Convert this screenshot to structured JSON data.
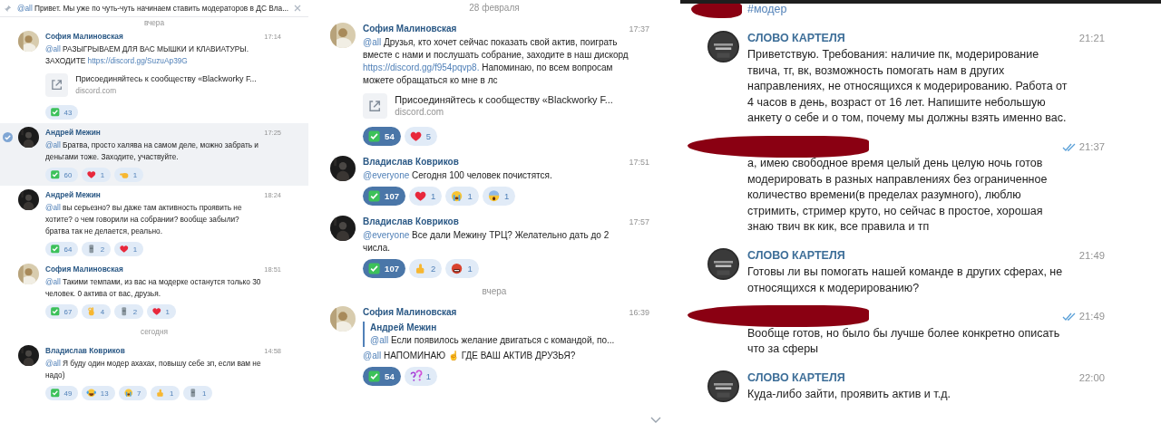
{
  "panels": [
    {
      "floating_date": "вчера",
      "pinned": {
        "parts": [
          {
            "kind": "mention",
            "text": "@all"
          },
          {
            "kind": "text",
            "text": " Привет. Мы уже по чуть-чуть начинаем ставить модераторов в ДС Вла..."
          }
        ]
      },
      "items": [
        {
          "kind": "message",
          "author": "София Малиновская",
          "time": "17:14",
          "selected": false,
          "parts": [
            {
              "kind": "mention",
              "text": "@all"
            },
            {
              "kind": "text",
              "text": " РАЗЫГРЫВАЕМ ДЛЯ ВАС МЫШКИ И КЛАВИАТУРЫ. ЗАХОДИТЕ "
            },
            {
              "kind": "link",
              "text": "https://discord.gg/SuzuAp39G"
            }
          ],
          "preview": {
            "title": "Присоединяйтесь к сообществу «Blackworky F...",
            "domain": "discord.com"
          },
          "reactions": [
            {
              "kind": "check",
              "count": "43",
              "selected": false
            }
          ]
        },
        {
          "kind": "message",
          "author": "Андрей Межин",
          "time": "17:25",
          "selected": true,
          "parts": [
            {
              "kind": "mention",
              "text": "@all"
            },
            {
              "kind": "text",
              "text": " Братва, просто халява на самом деле, можно забрать и деньгами тоже. Заходите, участвуйте."
            }
          ],
          "reactions": [
            {
              "kind": "check",
              "count": "60",
              "selected": false
            },
            {
              "kind": "heart",
              "count": "1",
              "selected": false
            },
            {
              "kind": "point",
              "count": "1",
              "selected": false
            }
          ]
        },
        {
          "kind": "message",
          "author": "Андрей Межин",
          "time": "18:24",
          "selected": false,
          "parts": [
            {
              "kind": "mention",
              "text": "@all"
            },
            {
              "kind": "text",
              "text": " вы серьезно? вы даже там активность проявить не хотите? о чем говорили на собрании? вообще забыли? братва так не делается, реально."
            }
          ],
          "reactions": [
            {
              "kind": "check",
              "count": "64",
              "selected": false
            },
            {
              "kind": "moai",
              "count": "2",
              "selected": false
            },
            {
              "kind": "heart",
              "count": "1",
              "selected": false
            }
          ]
        },
        {
          "kind": "message",
          "author": "София Малиновская",
          "time": "18:51",
          "selected": false,
          "parts": [
            {
              "kind": "mention",
              "text": "@all"
            },
            {
              "kind": "text",
              "text": " Такими темпами, из вас на модерке останутся только 30 человек. 0 актива от вас, друзья."
            }
          ],
          "reactions": [
            {
              "kind": "check",
              "count": "67",
              "selected": false
            },
            {
              "kind": "ok",
              "count": "4",
              "selected": false
            },
            {
              "kind": "moai",
              "count": "2",
              "selected": false
            },
            {
              "kind": "heart",
              "count": "1",
              "selected": false
            }
          ]
        },
        {
          "kind": "date",
          "text": "сегодня"
        },
        {
          "kind": "message",
          "author": "Владислав Ковриков",
          "time": "14:58",
          "selected": false,
          "parts": [
            {
              "kind": "mention",
              "text": "@all"
            },
            {
              "kind": "text",
              "text": " Я буду один модер ахахах, повышу себе зп, если вам не надо)"
            }
          ],
          "reactions": [
            {
              "kind": "check",
              "count": "49",
              "selected": false
            },
            {
              "kind": "laugh",
              "count": "13",
              "selected": false
            },
            {
              "kind": "cry",
              "count": "7",
              "selected": false
            },
            {
              "kind": "thumbs",
              "count": "1",
              "selected": false
            },
            {
              "kind": "moai",
              "count": "1",
              "selected": false
            }
          ]
        }
      ]
    },
    {
      "items": [
        {
          "kind": "date",
          "text": "28 февраля"
        },
        {
          "kind": "message",
          "author": "София Малиновская",
          "time": "17:37",
          "selected": false,
          "parts": [
            {
              "kind": "mention",
              "text": "@all"
            },
            {
              "kind": "text",
              "text": " Друзья, кто хочет сейчас показать свой актив, поиграть вместе с нами и послушать собрание, заходите в наш дискорд "
            },
            {
              "kind": "link",
              "text": "https://discord.gg/f954pqvp8."
            },
            {
              "kind": "text",
              "text": " Напоминаю, по всем вопросам можете обращаться ко мне в лс"
            }
          ],
          "preview": {
            "title": "Присоединяйтесь к сообществу «Blackworky F...",
            "domain": "discord.com"
          },
          "reactions": [
            {
              "kind": "check",
              "count": "54",
              "selected": true
            },
            {
              "kind": "heart",
              "count": "5",
              "selected": false
            }
          ]
        },
        {
          "kind": "message",
          "author": "Владислав Ковриков",
          "time": "17:51",
          "selected": false,
          "parts": [
            {
              "kind": "mention",
              "text": "@everyone"
            },
            {
              "kind": "text",
              "text": " Сегодня 100 человек почистятся."
            }
          ],
          "reactions": [
            {
              "kind": "check",
              "count": "107",
              "selected": true
            },
            {
              "kind": "heart",
              "count": "1",
              "selected": false
            },
            {
              "kind": "cry",
              "count": "1",
              "selected": false
            },
            {
              "kind": "scream",
              "count": "1",
              "selected": false
            }
          ]
        },
        {
          "kind": "message",
          "author": "Владислав Ковриков",
          "time": "17:57",
          "selected": false,
          "parts": [
            {
              "kind": "mention",
              "text": "@everyone"
            },
            {
              "kind": "text",
              "text": " Все дали Межину ТРЦ? Желательно дать до 2 числа."
            }
          ],
          "reactions": [
            {
              "kind": "check",
              "count": "107",
              "selected": true
            },
            {
              "kind": "thumbs",
              "count": "2",
              "selected": false
            },
            {
              "kind": "angry",
              "count": "1",
              "selected": false
            }
          ]
        },
        {
          "kind": "date",
          "text": "вчера"
        },
        {
          "kind": "message",
          "author": "София Малиновская",
          "time": "16:39",
          "selected": false,
          "reply": {
            "author": "Андрей Межин",
            "parts": [
              {
                "kind": "mention",
                "text": "@all"
              },
              {
                "kind": "text",
                "text": " Если появилось желание двигаться с командой, по..."
              }
            ]
          },
          "parts": [
            {
              "kind": "mention",
              "text": "@all"
            },
            {
              "kind": "text",
              "text": " НАПОМИНАЮ ☝ ГДЕ ВАШ АКТИВ ДРУЗЬЯ?"
            }
          ],
          "reactions": [
            {
              "kind": "check",
              "count": "54",
              "selected": true
            },
            {
              "kind": "question",
              "count": "1",
              "selected": false
            }
          ]
        }
      ]
    },
    {
      "items": [
        {
          "kind": "outgoing",
          "redacted": true,
          "read": false,
          "parts": [
            {
              "kind": "hashtag",
              "text": "#модер"
            }
          ]
        },
        {
          "kind": "incoming",
          "author": "СЛОВО КАРТЕЛЯ",
          "time": "21:21",
          "redacted": false,
          "read": false,
          "parts": [
            {
              "kind": "text",
              "text": "Приветствую. Требования: наличие пк, модерирование твича, тг, вк, возможность помогать нам в других направлениях, не относящихся к модерированию. Работа от 4 часов в день, возраст от 16 лет. Напишите небольшую анкету о себе и о том, почему мы должны взять именно вас."
            }
          ]
        },
        {
          "kind": "outgoing",
          "time": "21:37",
          "redacted": true,
          "read": true,
          "parts": [
            {
              "kind": "text",
              "text": "а, имею свободное время целый день целую ночь готов модерировать в разных направлениях без ограниченное количество времени(в пределах разумного), люблю стримить, стример круто, но сейчас в простое, хорошая знаю твич вк кик, все правила и тп"
            }
          ]
        },
        {
          "kind": "incoming",
          "author": "СЛОВО КАРТЕЛЯ",
          "time": "21:49",
          "redacted": false,
          "read": false,
          "parts": [
            {
              "kind": "text",
              "text": "Готовы ли вы помогать нашей команде в других сферах, не относящихся к модерированию?"
            }
          ]
        },
        {
          "kind": "outgoing",
          "time": "21:49",
          "redacted": true,
          "read": true,
          "parts": [
            {
              "kind": "text",
              "text": "Вообще готов, но было бы лучше более конкретно описать что за сферы"
            }
          ]
        },
        {
          "kind": "incoming",
          "author": "СЛОВО КАРТЕЛЯ",
          "time": "22:00",
          "redacted": false,
          "read": false,
          "parts": [
            {
              "kind": "text",
              "text": "Куда-либо зайти, проявить актив и т.д."
            }
          ]
        }
      ]
    }
  ]
}
